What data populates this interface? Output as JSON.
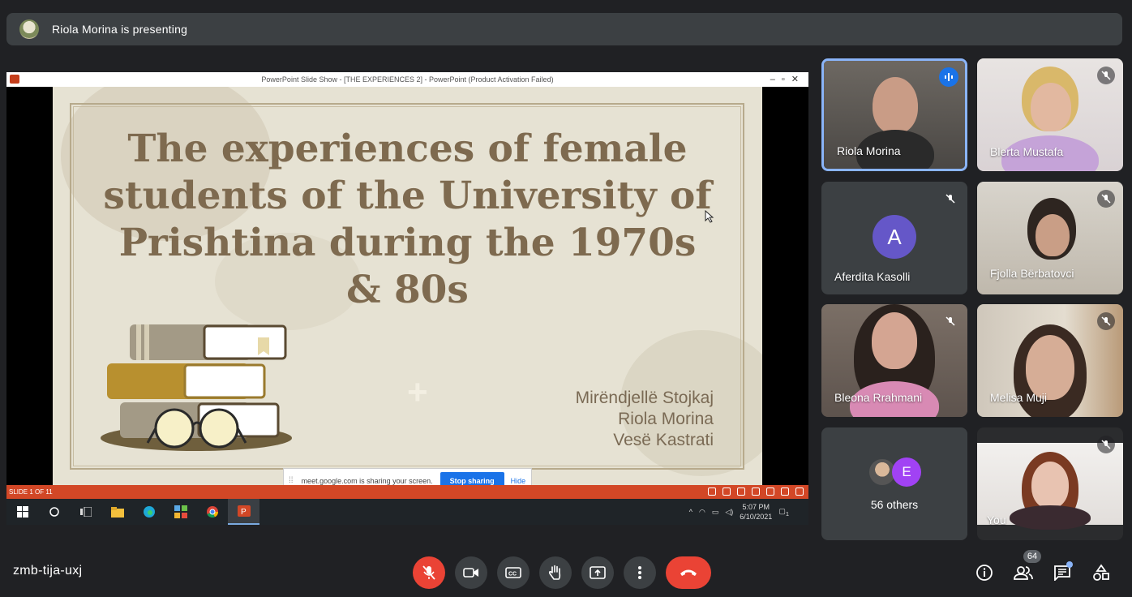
{
  "banner": {
    "text": "Riola Morina is presenting"
  },
  "screen": {
    "window_title": "PowerPoint Slide Show - [THE EXPERIENCES 2] - PowerPoint (Product Activation Failed)",
    "slide_title": "The experiences of female students of the University of Prishtina during the 1970s & 80s",
    "authors": [
      "Mirëndjellë Stojkaj",
      "Riola Morina",
      "Vesë Kastrati"
    ],
    "slide_counter": "SLIDE 1 OF 11",
    "share_message": "meet.google.com is sharing your screen.",
    "stop_sharing_label": "Stop sharing",
    "hide_label": "Hide",
    "clock_time": "5:07 PM",
    "clock_date": "6/10/2021",
    "notification_count": "1"
  },
  "participants": [
    {
      "name": "Riola Morina",
      "speaking": true
    },
    {
      "name": "Blerta Mustafa",
      "muted": true
    },
    {
      "name": "Aferdita Kasolli",
      "initial": "A",
      "muted": true
    },
    {
      "name": "Fjolla Bërbatovci",
      "muted": true
    },
    {
      "name": "Bleona Rrahmani",
      "muted": true
    },
    {
      "name": "Melisa Muji",
      "muted": true
    },
    {
      "name": "You",
      "muted": true
    }
  ],
  "others": {
    "label": "56 others",
    "initial": "E"
  },
  "meeting": {
    "code": "zmb-tija-uxj",
    "participant_count": "64"
  },
  "colors": {
    "accent": "#8ab4f8",
    "hangup": "#ea4335",
    "background": "#202124",
    "tile": "#3c4043"
  }
}
